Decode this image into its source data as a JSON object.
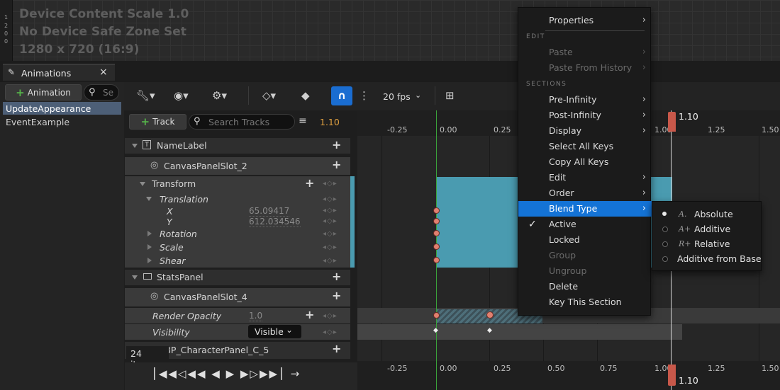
{
  "designer": {
    "ruler_digits": [
      "1",
      "2",
      "0",
      "0"
    ],
    "lines": [
      "Device Content Scale 1.0",
      "No Device Safe Zone Set",
      "1280 x 720 (16:9)"
    ]
  },
  "animations_panel": {
    "tab_title": "Animations",
    "close": "×",
    "add_button": "Animation",
    "search_placeholder": "Se",
    "items": [
      "UpdateAppearance",
      "EventExample"
    ]
  },
  "toolbar": {
    "fps": "20 fps",
    "snap_icon": "magnet-icon"
  },
  "tracks": {
    "add_track": "Track",
    "search_placeholder": "Search Tracks",
    "current_time": "1.10",
    "item_count": "24 items",
    "rows": {
      "name_label": "NameLabel",
      "slot2": "CanvasPanelSlot_2",
      "transform": "Transform",
      "translation": "Translation",
      "x": "X",
      "x_val": "65.09417",
      "y": "Y",
      "y_val": "612.034546",
      "rotation": "Rotation",
      "scale": "Scale",
      "shear": "Shear",
      "stats_panel": "StatsPanel",
      "slot4": "CanvasPanelSlot_4",
      "render_opacity": "Render Opacity",
      "opacity_val": "1.0",
      "visibility": "Visibility",
      "visibility_val": "Visible",
      "char_panel": "WBP_CharacterPanel_C_5"
    }
  },
  "timeline": {
    "ticks": [
      "-0.25",
      "0.00",
      "0.25",
      "0.50",
      "0.75",
      "1.00",
      "1.25",
      "1.50"
    ],
    "playhead": "1.10"
  },
  "context_menu": {
    "properties": "Properties",
    "sec_edit": "EDIT",
    "paste": "Paste",
    "paste_history": "Paste From History",
    "sec_sections": "SECTIONS",
    "pre_infinity": "Pre-Infinity",
    "post_infinity": "Post-Infinity",
    "display": "Display",
    "select_all_keys": "Select All Keys",
    "copy_all_keys": "Copy All Keys",
    "edit": "Edit",
    "order": "Order",
    "blend_type": "Blend Type",
    "active": "Active",
    "locked": "Locked",
    "group": "Group",
    "ungroup": "Ungroup",
    "delete": "Delete",
    "key_this_section": "Key This Section"
  },
  "blend_submenu": {
    "items": [
      {
        "icon": "A.",
        "label": "Absolute",
        "selected": true
      },
      {
        "icon": "A+",
        "label": "Additive",
        "selected": false
      },
      {
        "icon": "R+",
        "label": "Relative",
        "selected": false
      },
      {
        "icon": "",
        "label": "Additive from Base",
        "selected": false
      }
    ]
  },
  "colors": {
    "section_teal": "#4a9bb0",
    "menu_highlight": "#1473d6",
    "playhead": "#c8584a",
    "time_orange": "#e0a040"
  }
}
